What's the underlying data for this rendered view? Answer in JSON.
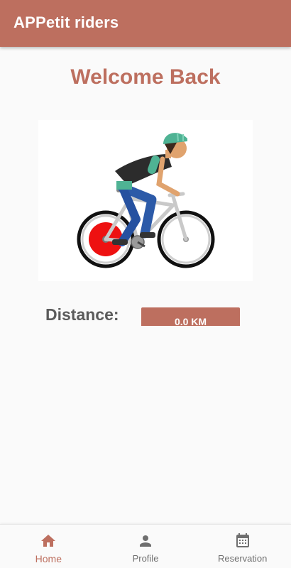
{
  "app_bar": {
    "title": "APPetit riders"
  },
  "main": {
    "welcome_text": "Welcome Back",
    "illustration": "cyclist-illustration",
    "distance_label": "Distance:",
    "distance_value": "0.0 KM"
  },
  "bottom_nav": {
    "items": [
      {
        "label": "Home",
        "icon": "home-icon",
        "active": true
      },
      {
        "label": "Profile",
        "icon": "person-icon",
        "active": false
      },
      {
        "label": "Reservation",
        "icon": "calendar-icon",
        "active": false
      }
    ]
  },
  "colors": {
    "primary": "#bd6f5f",
    "background": "#fafafa",
    "label_gray": "#5b5b5b",
    "nav_inactive": "#6f6f6f"
  }
}
